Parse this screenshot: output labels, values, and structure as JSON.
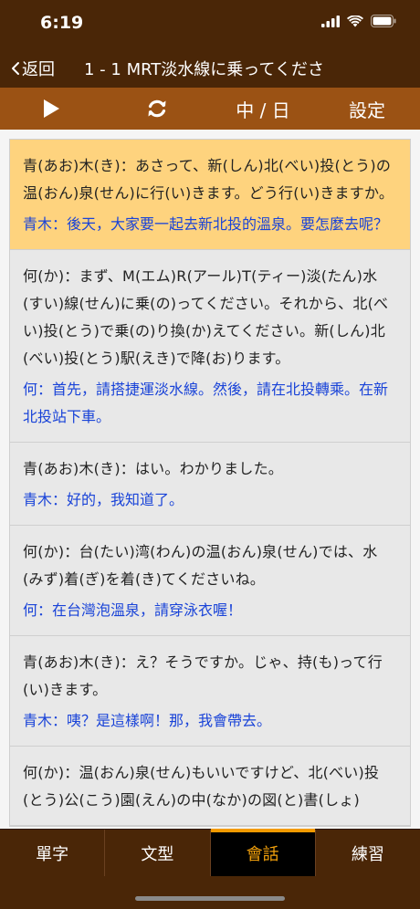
{
  "status": {
    "time": "6:19"
  },
  "nav": {
    "back_label": "返回",
    "title": "1 - 1 MRT淡水線に乗ってくださ"
  },
  "toolbar": {
    "lang_label": "中 / 日",
    "settings_label": "設定"
  },
  "dialogues": [
    {
      "jp": "青(あお)木(き)：あさって、新(しん)北(べい)投(とう)の温(おん)泉(せん)に行(い)きます。どう行(い)きますか。",
      "zh": "青木：後天，大家要一起去新北投的溫泉。要怎麼去呢？"
    },
    {
      "jp": "何(か)：まず、M(エム)R(アール)T(ティー)淡(たん)水(すい)線(せん)に乗(の)ってください。それから、北(べい)投(とう)で乗(の)り換(か)えてください。新(しん)北(べい)投(とう)駅(えき)で降(お)ります。",
      "zh": "何：首先，請搭捷運淡水線。然後，請在北投轉乘。在新北投站下車。"
    },
    {
      "jp": "青(あお)木(き)：はい。わかりました。",
      "zh": "青木：好的，我知道了。"
    },
    {
      "jp": "何(か)：台(たい)湾(わん)の温(おん)泉(せん)では、水(みず)着(ぎ)を着(き)てくださいね。",
      "zh": "何：在台灣泡溫泉，請穿泳衣喔！"
    },
    {
      "jp": "青(あお)木(き)：え？そうですか。じゃ、持(も)って行(い)きます。",
      "zh": "青木：咦？是這樣啊！那，我會帶去。"
    },
    {
      "jp": "何(か)：温(おん)泉(せん)もいいですけど、北(べい)投(とう)公(こう)園(えん)の中(なか)の図(と)書(しょ)",
      "zh": ""
    }
  ],
  "tabs": [
    {
      "label": "單字"
    },
    {
      "label": "文型"
    },
    {
      "label": "會話"
    },
    {
      "label": "練習"
    }
  ],
  "colors": {
    "header": "#4a2607",
    "toolbar": "#9b5214",
    "highlight": "#fed37e",
    "translation": "#1943d8",
    "active_tab": "#f5a20c"
  },
  "active_tab_index": 2,
  "highlight_index": 0
}
